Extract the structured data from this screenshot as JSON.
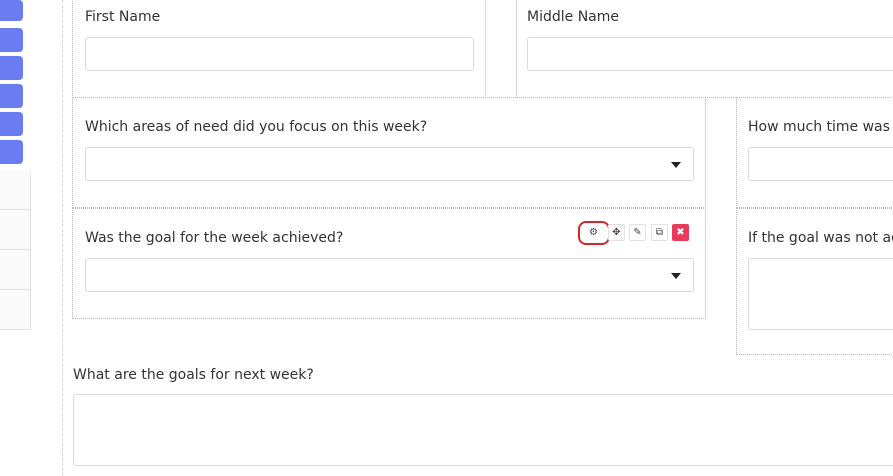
{
  "fields": {
    "first_name": {
      "label": "First Name",
      "value": ""
    },
    "middle_name": {
      "label": "Middle Name",
      "value": ""
    },
    "areas_of_need": {
      "label": "Which areas of need did you focus on this week?",
      "value": ""
    },
    "time_spent": {
      "label": "How much time was",
      "value": ""
    },
    "goal_achieved": {
      "label": "Was the goal for the week achieved?",
      "value": ""
    },
    "goal_not_achieved": {
      "label": "If the goal was not ac",
      "value": ""
    },
    "next_week_goals": {
      "label": "What are the goals for next week?",
      "value": ""
    }
  },
  "toolbar": {
    "settings": "⚙",
    "move": "✥",
    "edit": "✎",
    "copy": "⧉",
    "remove": "✖"
  },
  "colors": {
    "accent": "#6b7bf0",
    "danger": "#e83b5b",
    "highlight": "#d4262e"
  }
}
